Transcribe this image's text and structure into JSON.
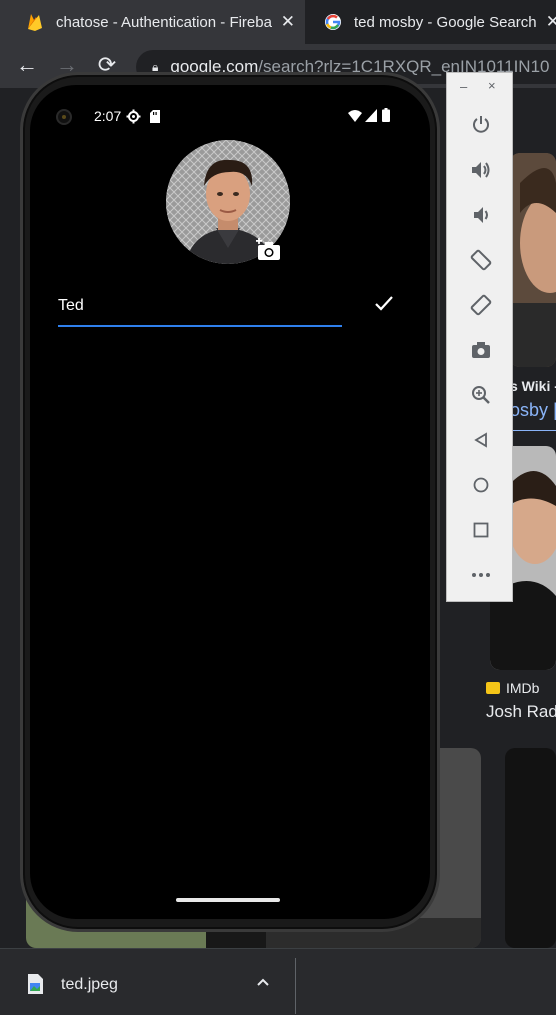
{
  "browser": {
    "tabs": [
      {
        "label": "chatose - Authentication - Fireba",
        "icon": "firebase-icon"
      },
      {
        "label": "ted mosby - Google Search",
        "icon": "google-icon"
      }
    ],
    "address": {
      "host": "google.com",
      "path": "/search?rlz=1C1RXQR_enIN1011IN10"
    }
  },
  "background_page": {
    "result_1": {
      "site": "s Wiki -",
      "title": "osby | H"
    },
    "result_2": {
      "source": "IMDb",
      "title": "Josh Rad"
    }
  },
  "phone": {
    "status_bar": {
      "time": "2:07"
    },
    "profile": {
      "name_value": "Ted"
    },
    "colors": {
      "accent": "#2f80ed",
      "screen_bg": "#000000"
    }
  },
  "emulator_panel": {
    "window_controls": {
      "minimize": "–",
      "close": "×"
    },
    "buttons": [
      "power-icon",
      "volume-up-icon",
      "volume-down-icon",
      "rotate-left-icon",
      "rotate-right-icon",
      "screenshot-icon",
      "zoom-icon",
      "back-icon",
      "home-icon",
      "overview-icon",
      "more-icon"
    ]
  },
  "downloads": {
    "file_name": "ted.jpeg"
  }
}
